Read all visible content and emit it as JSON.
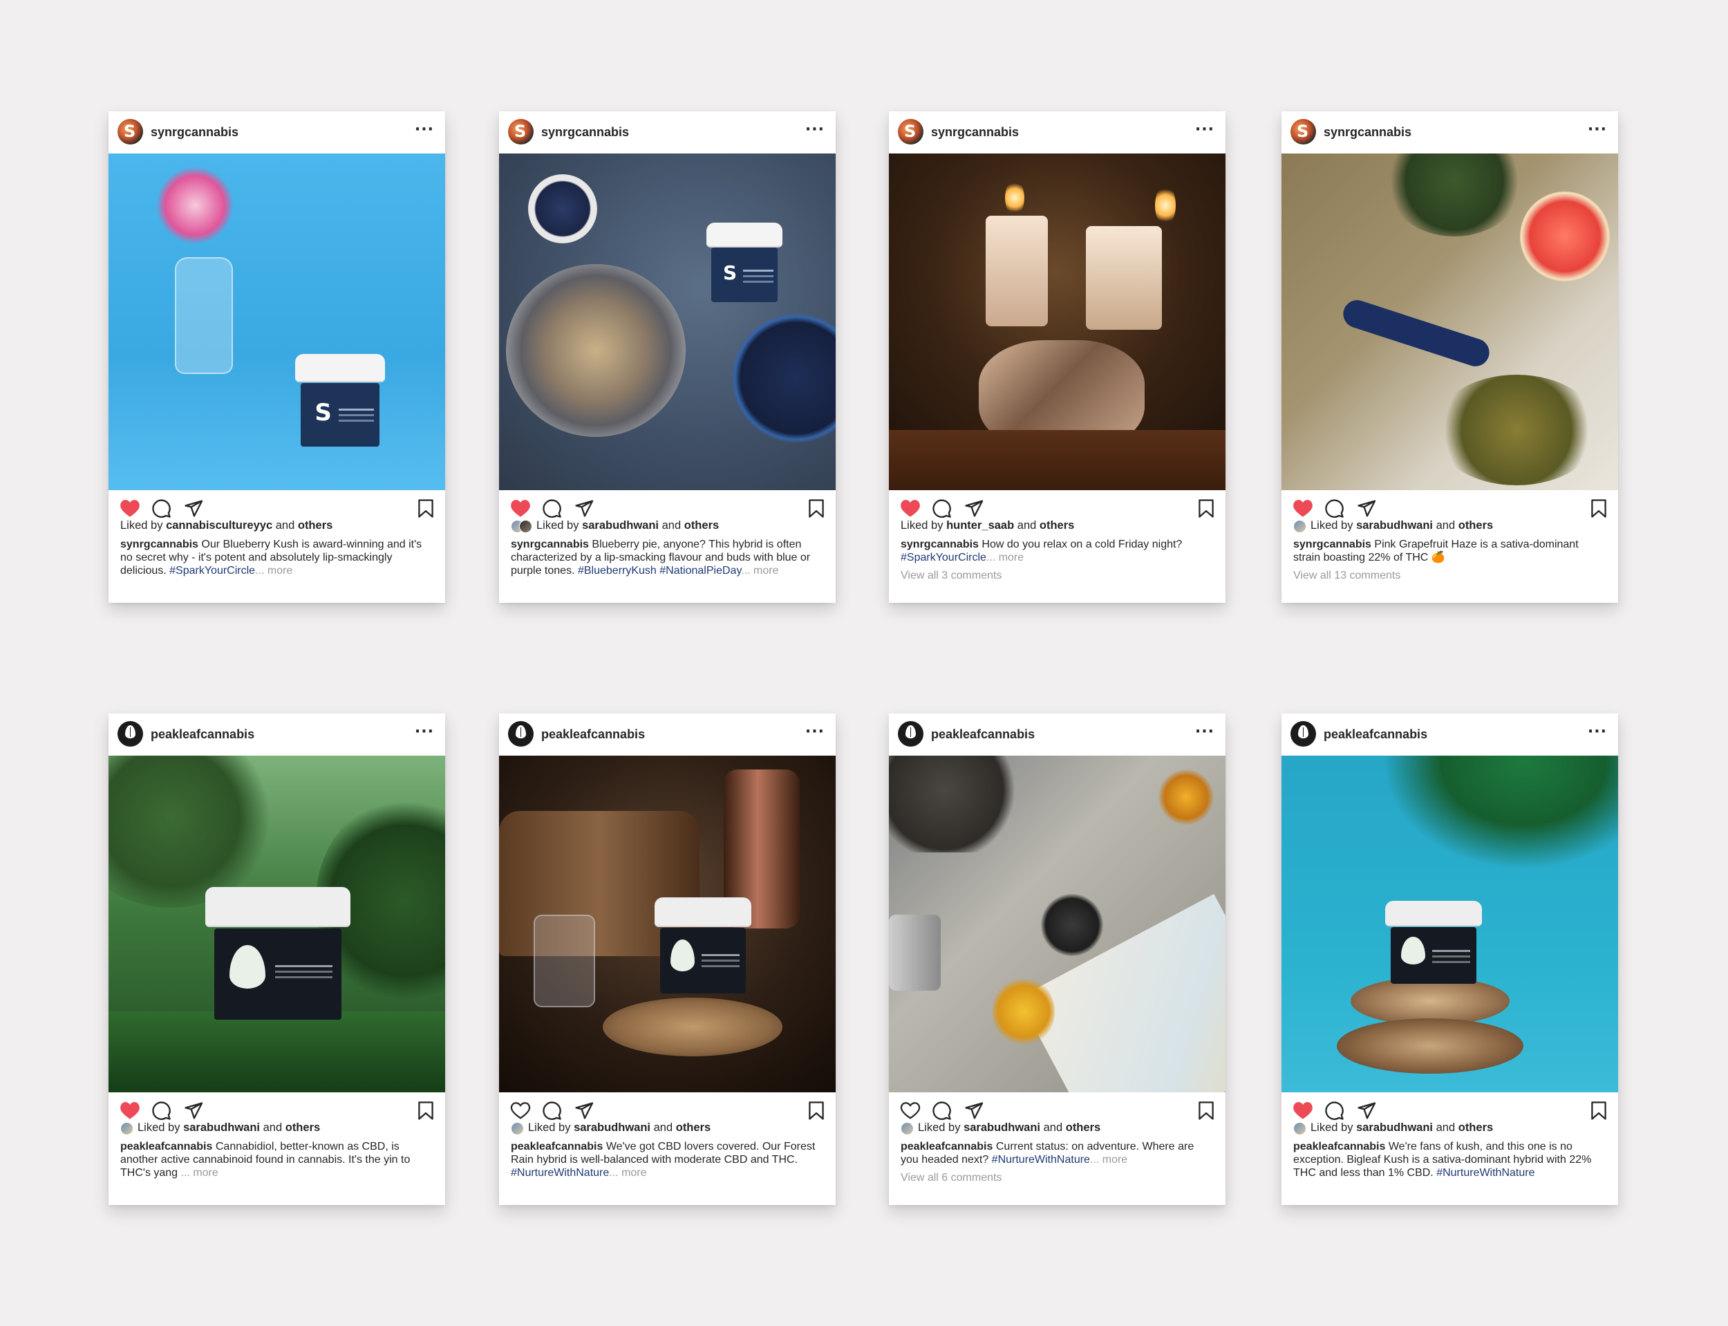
{
  "posts": [
    {
      "brand": "synrg",
      "username": "synrgcannabis",
      "scene": "blue",
      "liked": true,
      "show_liker_avatars": false,
      "liked_by_prefix": "Liked by",
      "liked_by_user": "cannabiscultureyyc",
      "liked_by_suffix": "and",
      "liked_by_others": "others",
      "caption_user": "synrgcannabis",
      "caption_text": "Our Blueberry Kush is award-winning and it's no secret why - it's potent and absolutely lip-smackingly delicious.",
      "caption_hashtags": "#SparkYourCircle",
      "caption_more": "... more",
      "comments": ""
    },
    {
      "brand": "synrg",
      "username": "synrgcannabis",
      "scene": "pie",
      "liked": true,
      "show_liker_avatars": true,
      "liked_by_prefix": "Liked by",
      "liked_by_user": "sarabudhwani",
      "liked_by_suffix": "and",
      "liked_by_others": "others",
      "caption_user": "synrgcannabis",
      "caption_text": "Blueberry pie, anyone? This hybrid is often characterized by a lip-smacking flavour and buds with blue or purple tones.",
      "caption_hashtags": "#BlueberryKush #NationalPieDay",
      "caption_more": "... more",
      "comments": ""
    },
    {
      "brand": "synrg",
      "username": "synrgcannabis",
      "scene": "candle",
      "liked": true,
      "show_liker_avatars": false,
      "liked_by_prefix": "Liked by",
      "liked_by_user": "hunter_saab",
      "liked_by_suffix": "and",
      "liked_by_others": "others",
      "caption_user": "synrgcannabis",
      "caption_text": "How do you relax on a cold Friday night?",
      "caption_hashtags": "#SparkYourCircle",
      "caption_more": "... more",
      "comments": "View all 3 comments"
    },
    {
      "brand": "synrg",
      "username": "synrgcannabis",
      "scene": "linen",
      "liked": true,
      "show_liker_avatars": true,
      "liked_by_prefix": "Liked by",
      "liked_by_user": "sarabudhwani",
      "liked_by_suffix": "and",
      "liked_by_others": "others",
      "caption_user": "synrgcannabis",
      "caption_text": "Pink Grapefruit Haze is a sativa-dominant strain boasting 22% of THC 🍊",
      "caption_hashtags": "",
      "caption_more": "",
      "comments": "View all 13 comments"
    },
    {
      "brand": "peak",
      "username": "peakleafcannabis",
      "scene": "green",
      "liked": true,
      "show_liker_avatars": true,
      "liked_by_prefix": "Liked by",
      "liked_by_user": "sarabudhwani",
      "liked_by_suffix": "and",
      "liked_by_others": "others",
      "caption_user": "peakleafcannabis",
      "caption_text": "Cannabidiol, better-known as CBD, is another active cannabinoid found in cannabis. It's the yin to THC's yang",
      "caption_hashtags": "",
      "caption_more": "... more",
      "comments": ""
    },
    {
      "brand": "peak",
      "username": "peakleafcannabis",
      "scene": "coffee",
      "liked": false,
      "show_liker_avatars": true,
      "liked_by_prefix": "Liked by",
      "liked_by_user": "sarabudhwani",
      "liked_by_suffix": "and",
      "liked_by_others": "others",
      "caption_user": "peakleafcannabis",
      "caption_text": "We've got CBD lovers covered. Our Forest Rain hybrid is well-balanced with moderate CBD and THC.",
      "caption_hashtags": "#NurtureWithNature",
      "caption_more": "... more",
      "comments": ""
    },
    {
      "brand": "peak",
      "username": "peakleafcannabis",
      "scene": "map",
      "liked": false,
      "show_liker_avatars": true,
      "liked_by_prefix": "Liked by",
      "liked_by_user": "sarabudhwani",
      "liked_by_suffix": "and",
      "liked_by_others": "others",
      "caption_user": "peakleafcannabis",
      "caption_text": "Current status: on adventure. Where are you headed next?",
      "caption_hashtags": "#NurtureWithNature",
      "caption_more": "... more",
      "comments": "View all 6 comments"
    },
    {
      "brand": "peak",
      "username": "peakleafcannabis",
      "scene": "teal",
      "liked": true,
      "show_liker_avatars": true,
      "liked_by_prefix": "Liked by",
      "liked_by_user": "sarabudhwani",
      "liked_by_suffix": "and",
      "liked_by_others": "others",
      "caption_user": "peakleafcannabis",
      "caption_text": "We're fans of kush, and this one is no exception. Bigleaf Kush is a sativa-dominant hybrid with 22% THC and less than 1% CBD.",
      "caption_hashtags": "#NurtureWithNature",
      "caption_more": "",
      "comments": ""
    }
  ],
  "ui": {
    "more_glyph": "···",
    "synrg_avatar_letter": "S",
    "like_color": "#ed4956",
    "icon_color": "#262626",
    "hashtag_color": "#1f3a74",
    "muted_color": "#9a9a9a",
    "background": "#f2eff0"
  }
}
